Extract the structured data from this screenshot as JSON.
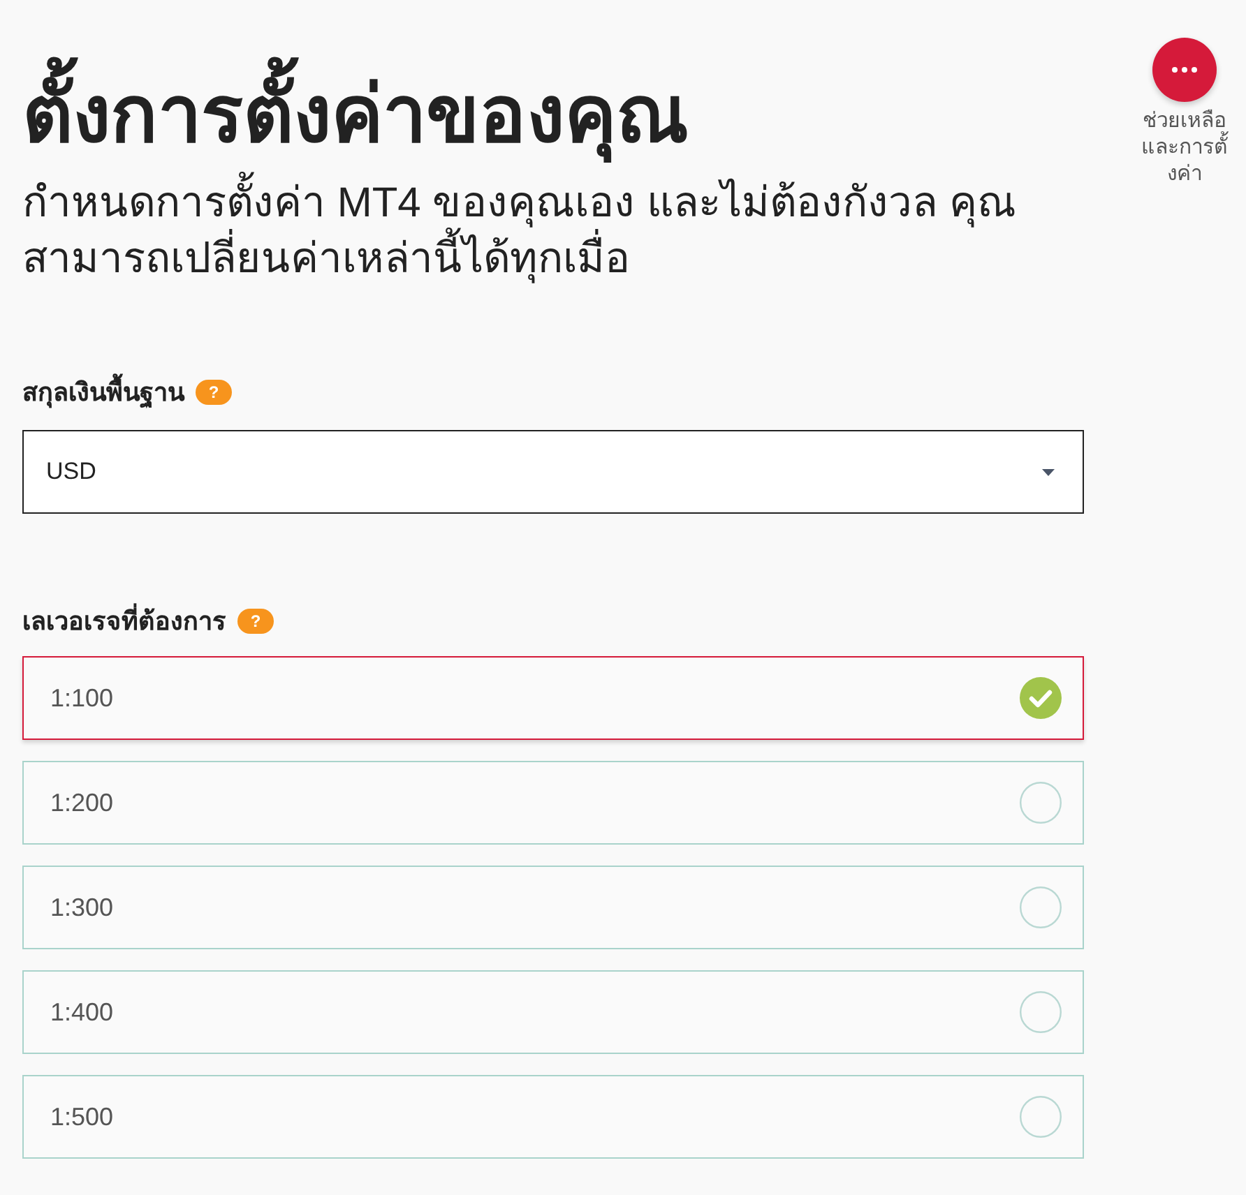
{
  "page": {
    "title": "ตั้งการตั้งค่าของคุณ",
    "subtitle": "กำหนดการตั้งค่า MT4 ของคุณเอง และไม่ต้องกังวล คุณสามารถเปลี่ยนค่าเหล่านี้ได้ทุกเมื่อ"
  },
  "help_menu": {
    "label": "ช่วยเหลือและการตั้งค่า"
  },
  "base_currency": {
    "label": "สกุลเงินพื้นฐาน",
    "hint": "?",
    "value": "USD"
  },
  "leverage": {
    "label": "เลเวอเรจที่ต้องการ",
    "hint": "?",
    "options": [
      {
        "label": "1:100",
        "selected": true
      },
      {
        "label": "1:200",
        "selected": false
      },
      {
        "label": "1:300",
        "selected": false
      },
      {
        "label": "1:400",
        "selected": false
      },
      {
        "label": "1:500",
        "selected": false
      }
    ]
  }
}
